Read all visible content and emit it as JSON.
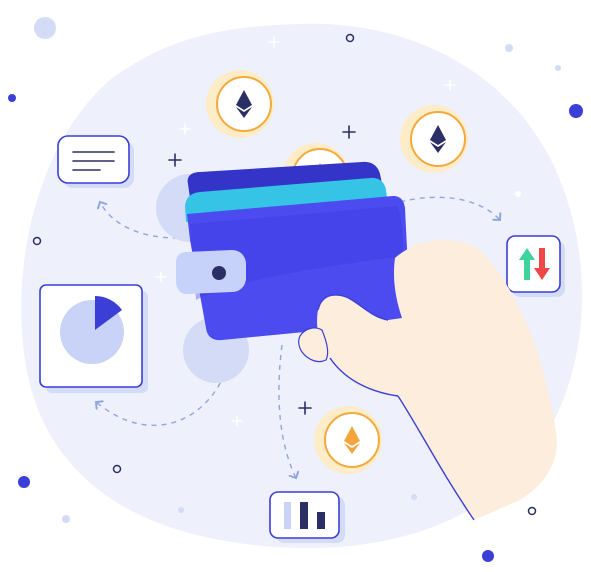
{
  "illustration": {
    "subject": "crypto-wallet-in-hand",
    "colors": {
      "blob": "#eef0fb",
      "wallet_dark": "#3a3ae0",
      "wallet_body": "#4b4bf0",
      "wallet_top": "#3434c8",
      "wallet_teal": "#35c4e6",
      "clasp": "#c7d2fb",
      "card_stroke": "#3b3fd6",
      "pie_light": "#c9d3f7",
      "pie_slice": "#3b3fd6",
      "coin_outer": "#fdecc8",
      "coin_ring": "#f5a93a",
      "coin_fill": "#ffffff",
      "eth_dark": "#2b2f66",
      "eth_orange": "#f3a53c",
      "arrow_up": "#3ed39a",
      "arrow_down": "#ef4646",
      "hand": "#fdeddc",
      "dashed": "#8fa6dc",
      "dot_dark": "#3b3fd6",
      "dot_light": "#d4dbf6"
    },
    "icons": [
      "ethereum-coin-icon",
      "pie-chart-icon",
      "bar-chart-icon",
      "up-down-arrows-icon",
      "text-card-icon",
      "wallet-icon",
      "hand-icon"
    ]
  }
}
